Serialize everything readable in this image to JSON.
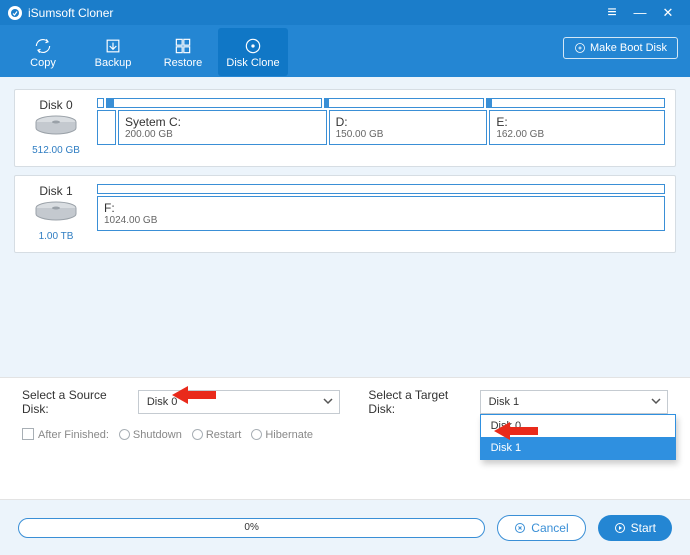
{
  "app": {
    "title": "iSumsoft Cloner"
  },
  "window": {
    "menu": "≡",
    "min": "—",
    "close": "✕"
  },
  "toolbar": {
    "copy": "Copy",
    "backup": "Backup",
    "restore": "Restore",
    "diskclone": "Disk Clone",
    "bootdisk": "Make Boot Disk"
  },
  "disks": [
    {
      "name": "Disk 0",
      "size": "512.00 GB",
      "topbar": [
        {
          "flex": 5,
          "fillPct": 0
        },
        {
          "flex": 195,
          "fillPct": 3
        },
        {
          "flex": 145,
          "fillPct": 3
        },
        {
          "flex": 162,
          "fillPct": 3
        }
      ],
      "parts": [
        {
          "flex": 5,
          "name": "",
          "size": ""
        },
        {
          "flex": 195,
          "name": "Syetem C:",
          "size": "200.00 GB"
        },
        {
          "flex": 145,
          "name": "D:",
          "size": "150.00 GB"
        },
        {
          "flex": 162,
          "name": "E:",
          "size": "162.00 GB"
        }
      ]
    },
    {
      "name": "Disk 1",
      "size": "1.00 TB",
      "topbar": [
        {
          "flex": 1,
          "fillPct": 0
        }
      ],
      "parts": [
        {
          "flex": 1,
          "name": "F:",
          "size": "1024.00 GB"
        }
      ]
    }
  ],
  "select": {
    "sourceLabel": "Select a Source Disk:",
    "sourceValue": "Disk 0",
    "targetLabel": "Select a Target Disk:",
    "targetValue": "Disk 1",
    "options": [
      "Disk 0",
      "Disk 1"
    ],
    "selectedOption": "Disk 1"
  },
  "after": {
    "label": "After Finished:",
    "shutdown": "Shutdown",
    "restart": "Restart",
    "hibernate": "Hibernate"
  },
  "footer": {
    "progress": "0%",
    "cancel": "Cancel",
    "start": "Start"
  }
}
